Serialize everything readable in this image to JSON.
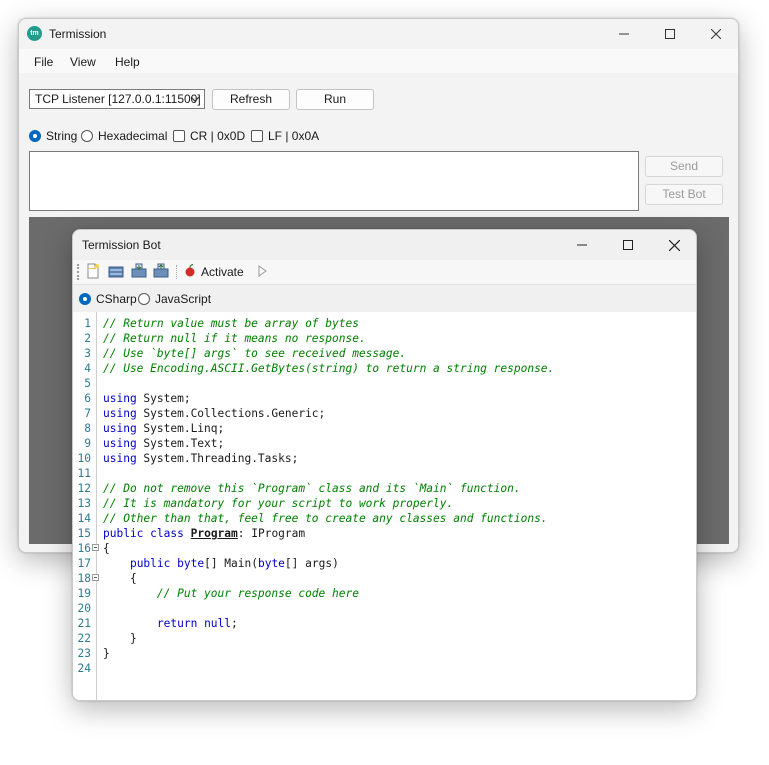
{
  "main_window": {
    "title": "Termission",
    "logo_text": "tm",
    "menu": [
      "File",
      "View",
      "Help"
    ],
    "connection": {
      "selected": "TCP Listener [127.0.0.1:11500]",
      "refresh_label": "Refresh",
      "run_label": "Run"
    },
    "options": {
      "string_label": "String",
      "hex_label": "Hexadecimal",
      "cr_label": "CR | 0x0D",
      "lf_label": "LF | 0x0A",
      "selected": "String",
      "cr_checked": false,
      "lf_checked": false
    },
    "message": {
      "value": ""
    },
    "send_label": "Send",
    "test_bot_label": "Test Bot"
  },
  "bot_window": {
    "title": "Termission Bot",
    "toolbar": {
      "icons": [
        "new-file-icon",
        "open-file-icon",
        "save-icon",
        "save-as-icon",
        "activate-icon",
        "play-icon"
      ],
      "activate_label": "Activate"
    },
    "language": {
      "csharp_label": "CSharp",
      "javascript_label": "JavaScript",
      "selected": "CSharp"
    },
    "editor": {
      "lines": [
        {
          "n": "1",
          "fold": false,
          "tokens": [
            {
              "t": "// Return value must be array of bytes",
              "c": "comment"
            }
          ]
        },
        {
          "n": "2",
          "fold": false,
          "tokens": [
            {
              "t": "// Return null if it means no response.",
              "c": "comment"
            }
          ]
        },
        {
          "n": "3",
          "fold": false,
          "tokens": [
            {
              "t": "// Use `byte[] args` to see received message.",
              "c": "comment"
            }
          ]
        },
        {
          "n": "4",
          "fold": false,
          "tokens": [
            {
              "t": "// Use Encoding.ASCII.GetBytes(string) to return a string response.",
              "c": "comment"
            }
          ]
        },
        {
          "n": "5",
          "fold": false,
          "tokens": []
        },
        {
          "n": "6",
          "fold": false,
          "tokens": [
            {
              "t": "using",
              "c": "kw"
            },
            {
              "t": " System;",
              "c": "plain"
            }
          ]
        },
        {
          "n": "7",
          "fold": false,
          "tokens": [
            {
              "t": "using",
              "c": "kw"
            },
            {
              "t": " System.Collections.Generic;",
              "c": "plain"
            }
          ]
        },
        {
          "n": "8",
          "fold": false,
          "tokens": [
            {
              "t": "using",
              "c": "kw"
            },
            {
              "t": " System.Linq;",
              "c": "plain"
            }
          ]
        },
        {
          "n": "9",
          "fold": false,
          "tokens": [
            {
              "t": "using",
              "c": "kw"
            },
            {
              "t": " System.Text;",
              "c": "plain"
            }
          ]
        },
        {
          "n": "10",
          "fold": false,
          "tokens": [
            {
              "t": "using",
              "c": "kw"
            },
            {
              "t": " System.Threading.Tasks;",
              "c": "plain"
            }
          ]
        },
        {
          "n": "11",
          "fold": false,
          "tokens": []
        },
        {
          "n": "12",
          "fold": false,
          "tokens": [
            {
              "t": "// Do not remove this `Program` class and its `Main` function.",
              "c": "comment"
            }
          ]
        },
        {
          "n": "13",
          "fold": false,
          "tokens": [
            {
              "t": "// It is mandatory for your script to work properly.",
              "c": "comment"
            }
          ]
        },
        {
          "n": "14",
          "fold": false,
          "tokens": [
            {
              "t": "// Other than that, feel free to create any classes and functions.",
              "c": "comment"
            }
          ]
        },
        {
          "n": "15",
          "fold": false,
          "tokens": [
            {
              "t": "public",
              "c": "kw"
            },
            {
              "t": " ",
              "c": "plain"
            },
            {
              "t": "class",
              "c": "kw"
            },
            {
              "t": " ",
              "c": "plain"
            },
            {
              "t": "Program",
              "c": "class"
            },
            {
              "t": ": IProgram",
              "c": "plain"
            }
          ]
        },
        {
          "n": "16",
          "fold": true,
          "tokens": [
            {
              "t": "{",
              "c": "plain"
            }
          ]
        },
        {
          "n": "17",
          "fold": false,
          "tokens": [
            {
              "t": "    ",
              "c": "plain"
            },
            {
              "t": "public",
              "c": "kw"
            },
            {
              "t": " ",
              "c": "plain"
            },
            {
              "t": "byte",
              "c": "kw"
            },
            {
              "t": "[] Main(",
              "c": "plain"
            },
            {
              "t": "byte",
              "c": "kw"
            },
            {
              "t": "[] args)",
              "c": "plain"
            }
          ]
        },
        {
          "n": "18",
          "fold": true,
          "tokens": [
            {
              "t": "    {",
              "c": "plain"
            }
          ]
        },
        {
          "n": "19",
          "fold": false,
          "tokens": [
            {
              "t": "        ",
              "c": "plain"
            },
            {
              "t": "// Put your response code here",
              "c": "comment"
            }
          ]
        },
        {
          "n": "20",
          "fold": false,
          "tokens": []
        },
        {
          "n": "21",
          "fold": false,
          "tokens": [
            {
              "t": "        ",
              "c": "plain"
            },
            {
              "t": "return",
              "c": "kw"
            },
            {
              "t": " ",
              "c": "plain"
            },
            {
              "t": "null",
              "c": "kw"
            },
            {
              "t": ";",
              "c": "plain"
            }
          ]
        },
        {
          "n": "22",
          "fold": false,
          "tokens": [
            {
              "t": "    }",
              "c": "plain"
            }
          ]
        },
        {
          "n": "23",
          "fold": false,
          "tokens": [
            {
              "t": "}",
              "c": "plain"
            }
          ]
        },
        {
          "n": "24",
          "fold": false,
          "tokens": []
        }
      ]
    }
  }
}
